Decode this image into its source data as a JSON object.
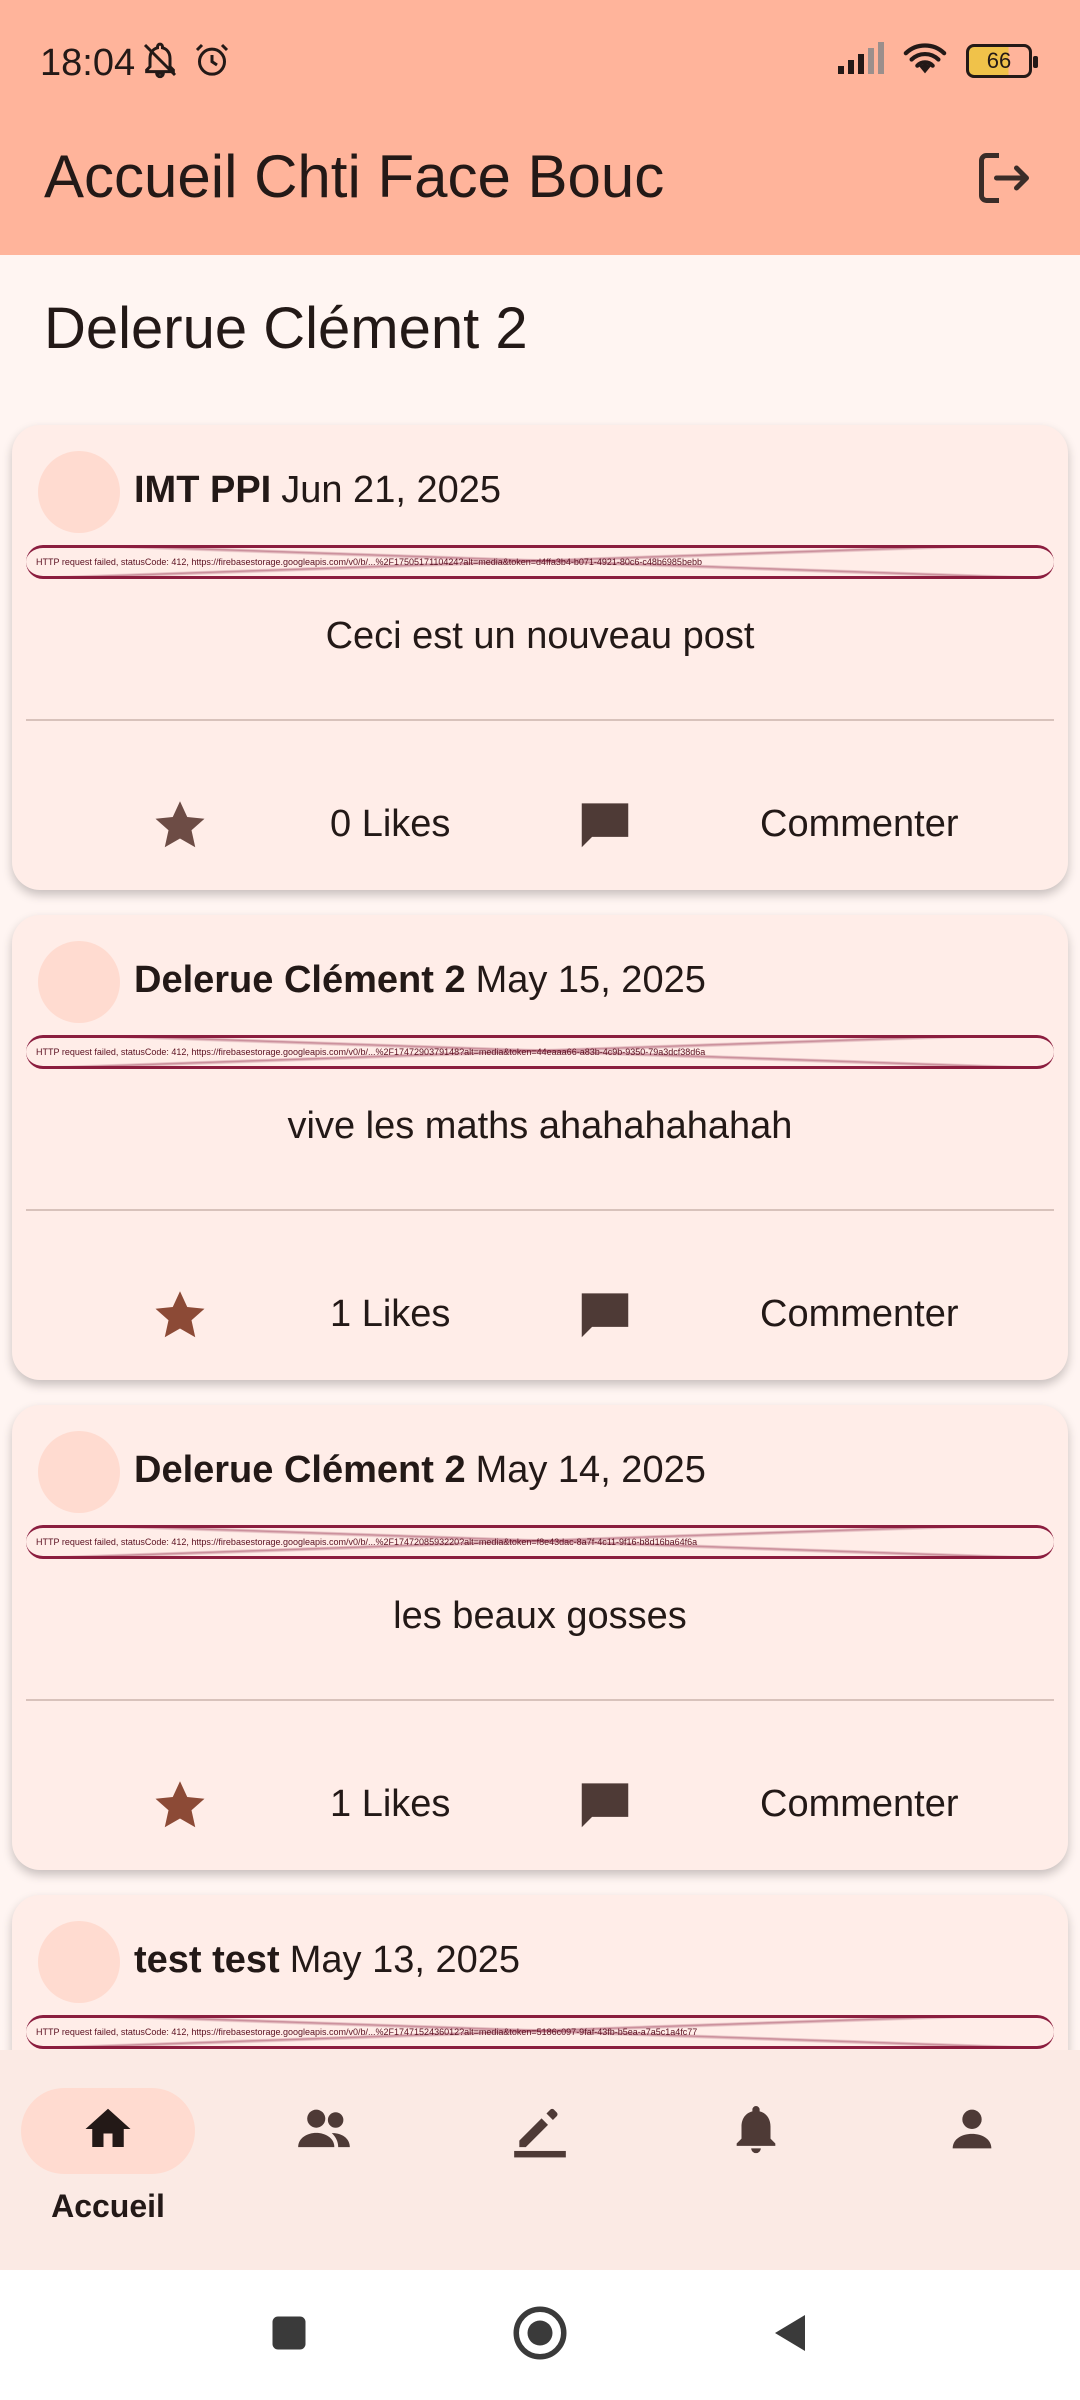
{
  "status_bar": {
    "time": "18:04",
    "battery": "66"
  },
  "app_bar": {
    "title": "Accueil Chti Face Bouc",
    "logout_icon": "logout-icon"
  },
  "profile": {
    "name": "Delerue  Clément 2"
  },
  "posts": [
    {
      "author": "IMT PPI",
      "date": "Jun 21, 2025",
      "image_error": "HTTP request failed, statusCode: 412, https://firebasestorage.googleapis.com/v0/b/...%2F1750517110424?alt=media&token=d4ffa3b4-b071-4921-80c6-c48b6985bebb",
      "content": "Ceci est un nouveau post",
      "likes": "0 Likes",
      "liked": false,
      "comment_label": "Commenter"
    },
    {
      "author": "Delerue  Clément 2",
      "date": "May 15, 2025",
      "image_error": "HTTP request failed, statusCode: 412, https://firebasestorage.googleapis.com/v0/b/...%2F1747290379148?alt=media&token=44eaaa66-a83b-4c9b-9350-79a3dcf38d6a",
      "content": "vive les maths ahahahahahah",
      "likes": "1 Likes",
      "liked": true,
      "comment_label": "Commenter"
    },
    {
      "author": "Delerue  Clément 2",
      "date": "May 14, 2025",
      "image_error": "HTTP request failed, statusCode: 412, https://firebasestorage.googleapis.com/v0/b/...%2F1747208593220?alt=media&token=f8e43dac-8a7f-4c11-9f16-b8d16ba64f6a",
      "content": "les beaux gosses",
      "likes": "1 Likes",
      "liked": true,
      "comment_label": "Commenter"
    },
    {
      "author": "test test",
      "date": "May 13, 2025",
      "image_error": "HTTP request failed, statusCode: 412, https://firebasestorage.googleapis.com/v0/b/...%2F1747152436012?alt=media&token=5186c097-9faf-43fb-b5ea-a7a5c1a4fc77"
    }
  ],
  "bottom_nav": {
    "items": [
      {
        "icon": "home-icon",
        "label": "Accueil",
        "active": true
      },
      {
        "icon": "people-icon",
        "label": "",
        "active": false
      },
      {
        "icon": "edit-icon",
        "label": "",
        "active": false
      },
      {
        "icon": "bell-icon",
        "label": "",
        "active": false
      },
      {
        "icon": "person-icon",
        "label": "",
        "active": false
      }
    ]
  },
  "colors": {
    "app_bar": "#ffb49b",
    "background": "#fff5f2",
    "card": "#ffede8",
    "avatar": "#ffdbd0",
    "liked_star": "#8c4a36",
    "unliked_star": "#6d4c45",
    "comment_icon": "#4e3a36",
    "image_error_border": "#8b1e3f"
  }
}
